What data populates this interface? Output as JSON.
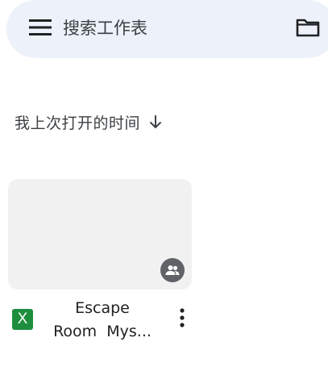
{
  "search": {
    "placeholder": "搜索工作表",
    "menu_icon": "menu-icon",
    "folder_icon": "folder-icon"
  },
  "sort": {
    "label": "我上次打开的时间",
    "direction_icon": "arrow-down-icon"
  },
  "files": [
    {
      "name_line1": "Escape",
      "name_line2": "Room  Mys...",
      "type_icon_letter": "X",
      "type_color": "#1e8e3e",
      "shared": true,
      "shared_icon": "people-icon",
      "more_icon": "more-vert-icon"
    }
  ],
  "colors": {
    "search_bg": "#edf2fa",
    "thumb_bg": "#f1f1f1",
    "badge_bg": "#5f6368"
  }
}
